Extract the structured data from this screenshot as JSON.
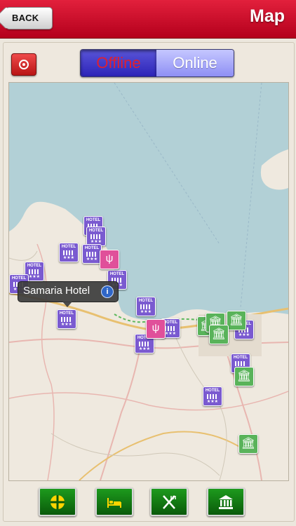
{
  "header": {
    "back_label": "BACK",
    "title": "Map"
  },
  "segment": {
    "offline_label": "Offline",
    "online_label": "Online",
    "selected": "Offline"
  },
  "map": {
    "callout_label": "Samaria Hotel",
    "callout_info": "i"
  },
  "icons": {
    "locate": "target-icon",
    "hotel_pin": "hotel-icon",
    "museum_pin": "museum-icon",
    "restaurant_pin": "restaurant-icon"
  },
  "toolbar": {
    "items": [
      {
        "icon": "crosshair-icon"
      },
      {
        "icon": "bed-icon"
      },
      {
        "icon": "fork-knife-icon"
      },
      {
        "icon": "museum-icon"
      }
    ]
  },
  "colors": {
    "header": "#c8102e",
    "sea": "#b2d0d6",
    "toolbar_button": "#138013",
    "selected_segment": "#3a33c7"
  }
}
